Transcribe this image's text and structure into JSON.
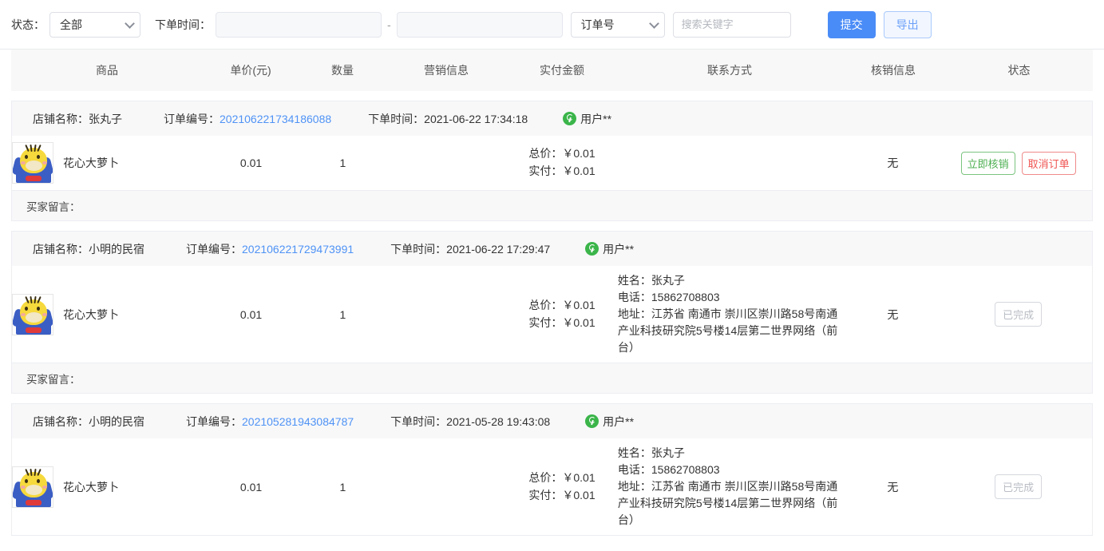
{
  "toolbar": {
    "status_label": "状态：",
    "status_value": "全部",
    "status_options": [
      "全部"
    ],
    "date_label": "下单时间：",
    "date_start_value": "",
    "date_end_value": "",
    "date_start_placeholder": "",
    "date_end_placeholder": "",
    "date_separator": "-",
    "keytype_value": "订单号",
    "keytype_options": [
      "订单号"
    ],
    "keyword_value": "",
    "keyword_placeholder": "搜索关键字",
    "submit_label": "提交",
    "export_label": "导出"
  },
  "table": {
    "headers": [
      "商品",
      "单价(元)",
      "数量",
      "营销信息",
      "实付金额",
      "联系方式",
      "核销信息",
      "状态"
    ],
    "labels": {
      "shop_prefix": "店铺名称：",
      "order_no_prefix": "订单编号：",
      "order_time_prefix": "下单时间：",
      "buyer_message_prefix": "买家留言：",
      "total_prefix": "总价：",
      "paid_prefix": "实付："
    }
  },
  "orders": [
    {
      "shop_name": "店铺名称：张丸子",
      "order_no_label": "订单编号：",
      "order_no": "202106221734186088",
      "order_time": "下单时间：2021-06-22 17:34:18",
      "user_name": "用户**",
      "goods_name": "花心大萝卜",
      "unit_price": "0.01",
      "quantity": "1",
      "promotion": "",
      "total_text": "总价：￥0.01",
      "paid_text": "实付：￥0.01",
      "contact_name": "",
      "contact_phone": "",
      "contact_addr": "",
      "verify_info": "无",
      "status_type": "actions",
      "action_verify": "立即核销",
      "action_cancel": "取消订单",
      "status_done": "",
      "buyer_message": "买家留言："
    },
    {
      "shop_name": "店铺名称：小明的民宿",
      "order_no_label": "订单编号：",
      "order_no": "202106221729473991",
      "order_time": "下单时间：2021-06-22 17:29:47",
      "user_name": "用户**",
      "goods_name": "花心大萝卜",
      "unit_price": "0.01",
      "quantity": "1",
      "promotion": "",
      "total_text": "总价：￥0.01",
      "paid_text": "实付：￥0.01",
      "contact_name": "姓名：张丸子",
      "contact_phone": "电话：15862708803",
      "contact_addr": "地址：江苏省 南通市 崇川区崇川路58号南通产业科技研究院5号楼14层第二世界网络（前台）",
      "verify_info": "无",
      "status_type": "done",
      "action_verify": "",
      "action_cancel": "",
      "status_done": "已完成",
      "buyer_message": "买家留言："
    },
    {
      "shop_name": "店铺名称：小明的民宿",
      "order_no_label": "订单编号：",
      "order_no": "202105281943084787",
      "order_time": "下单时间：2021-05-28 19:43:08",
      "user_name": "用户**",
      "goods_name": "花心大萝卜",
      "unit_price": "0.01",
      "quantity": "1",
      "promotion": "",
      "total_text": "总价：￥0.01",
      "paid_text": "实付：￥0.01",
      "contact_name": "姓名：张丸子",
      "contact_phone": "电话：15862708803",
      "contact_addr": "地址：江苏省 南通市 崇川区崇川路58号南通产业科技研究院5号楼14层第二世界网络（前台）",
      "verify_info": "无",
      "status_type": "done",
      "action_verify": "",
      "action_cancel": "",
      "status_done": "已完成",
      "buyer_message": ""
    }
  ],
  "colors": {
    "primary": "#4a8cf7",
    "link": "#4f93f5",
    "success": "#4caf50",
    "danger": "#ef5350",
    "wechat_green": "#3bb54a",
    "header_bg": "#f8f8f9"
  }
}
